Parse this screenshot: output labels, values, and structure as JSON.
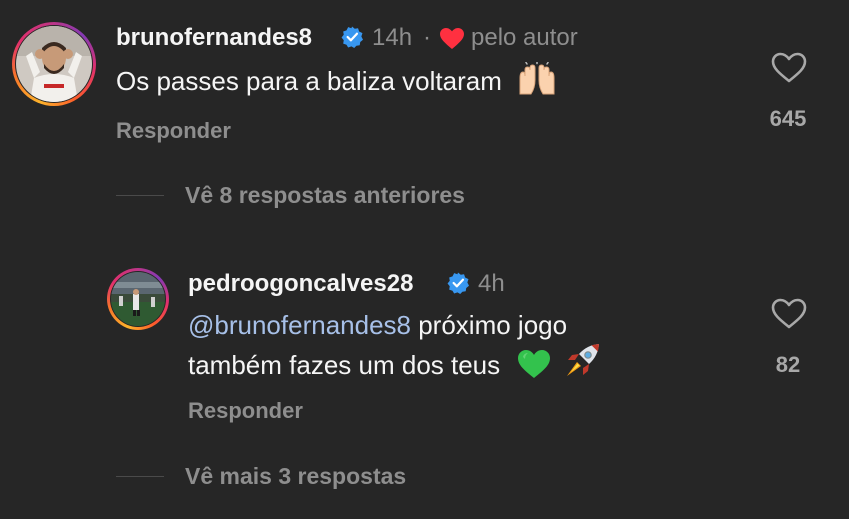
{
  "comments": [
    {
      "username": "brunofernandes8",
      "time": "14h",
      "separator": "·",
      "liked_by_author_label": "pelo autor",
      "text": "Os passes para a baliza voltaram",
      "emoji": "raising-hands",
      "reply_label": "Responder",
      "like_count": "645"
    },
    {
      "username": "pedroogoncalves28",
      "time": "4h",
      "mention": "@brunofernandes8",
      "text_line1": " próximo jogo",
      "text_line2": "também fazes um dos teus",
      "emojis": [
        "green-heart",
        "rocket"
      ],
      "reply_label": "Responder",
      "like_count": "82"
    }
  ],
  "view_previous_replies": "Vê 8 respostas anteriores",
  "view_more_replies": "Vê mais 3 respostas",
  "colors": {
    "background": "#262626",
    "primary_text": "#f5f5f5",
    "secondary_text": "#8e8e8e",
    "verified_blue": "#3897f0",
    "author_heart": "#ff3040",
    "mention": "#a7c0e8"
  }
}
